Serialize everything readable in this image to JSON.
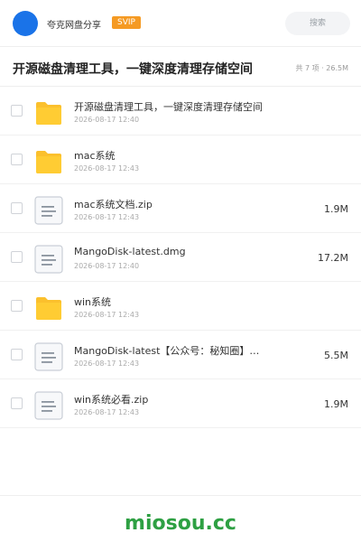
{
  "header": {
    "app_name": "夸克网盘分享",
    "badge": "SVIP",
    "search_label": "搜索"
  },
  "share": {
    "title": "开源磁盘清理工具，一键深度清理存储空间",
    "summary": "共 7 项 · 26.5M"
  },
  "files": [
    {
      "type": "folder",
      "name": "开源磁盘清理工具，一键深度清理存储空间",
      "date": "2026-08-17 12:40",
      "size": ""
    },
    {
      "type": "folder",
      "name": "mac系统",
      "date": "2026-08-17 12:43",
      "size": ""
    },
    {
      "type": "file",
      "name": "mac系统文档.zip",
      "date": "2026-08-17 12:43",
      "size": "1.9M"
    },
    {
      "type": "file",
      "name": "MangoDisk-latest.dmg",
      "date": "2026-08-17 12:40",
      "size": "17.2M"
    },
    {
      "type": "folder",
      "name": "win系统",
      "date": "2026-08-17 12:43",
      "size": ""
    },
    {
      "type": "file",
      "name": "MangoDisk-latest【公众号：秘知圈】…",
      "date": "2026-08-17 12:43",
      "size": "5.5M"
    },
    {
      "type": "file",
      "name": "win系统必看.zip",
      "date": "2026-08-17 12:43",
      "size": "1.9M"
    }
  ],
  "footer": {
    "brand": "miosou.cc"
  },
  "colors": {
    "avatar": "#1a73e8",
    "badge": "#f59a23",
    "folder": "#fbc02d",
    "brand": "#2ea043"
  }
}
